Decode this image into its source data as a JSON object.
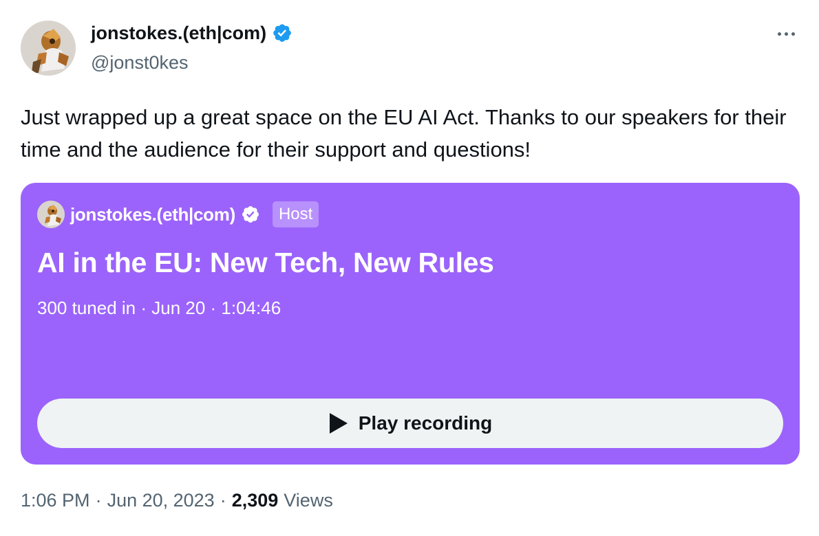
{
  "tweet": {
    "author": {
      "name": "jonstokes.(eth|com)",
      "handle": "@jonst0kes",
      "avatar_icon": "robot-avatar",
      "verified_color": "#1d9bf0"
    },
    "text": "Just wrapped up a great space on the EU AI Act. Thanks to our speakers for their time and the audience for their support and questions!",
    "space": {
      "background_color": "#9b63fb",
      "host_name": "jonstokes.(eth|com)",
      "host_label": "Host",
      "title": "AI in the EU: New Tech, New Rules",
      "meta": "300 tuned in · Jun 20 · 1:04:46",
      "play_label": "Play recording",
      "play_icon": "play-icon"
    },
    "footer": {
      "time": "1:06 PM",
      "date": "Jun 20, 2023",
      "views_count": "2,309",
      "views_label": "Views"
    }
  }
}
